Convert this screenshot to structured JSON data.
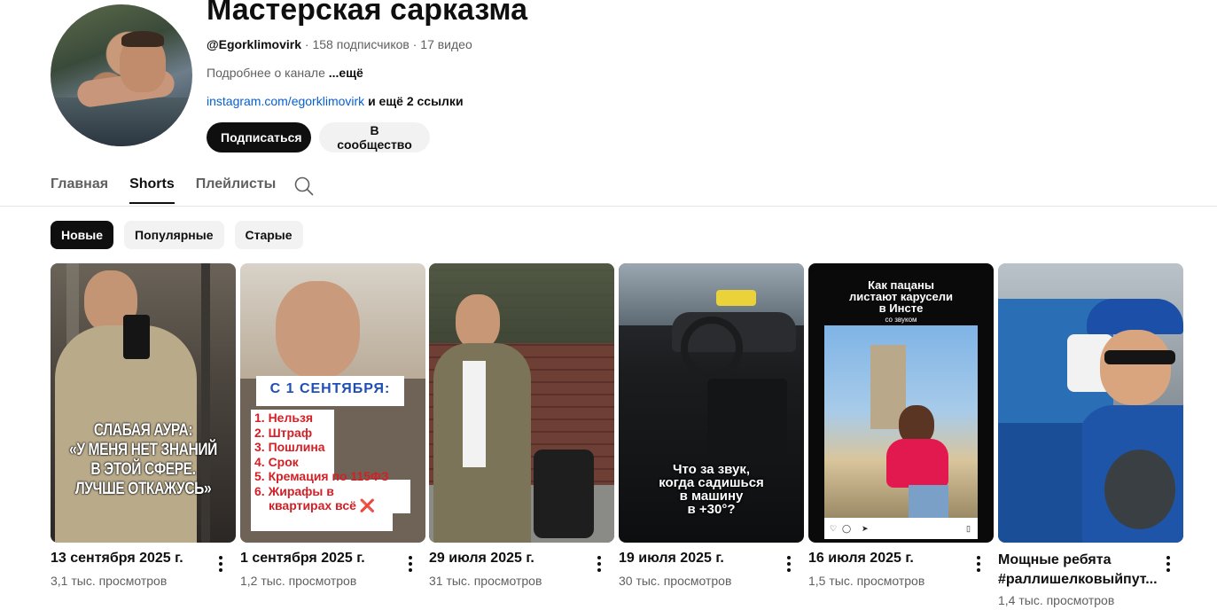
{
  "channel": {
    "title": "Мастерская сарказма",
    "handle": "@Egorklimovirk",
    "subscribers": "158 подписчиков",
    "videos": "17 видео",
    "separator": "·",
    "about_text": "Подробнее о канале",
    "about_more": "...ещё",
    "link_text": "instagram.com/egorklimovirk",
    "links_more": "и ещё 2 ссылки",
    "subscribe_label": "Подписаться",
    "community_label": "В сообщество"
  },
  "tabs": [
    {
      "label": "Главная",
      "active": false
    },
    {
      "label": "Shorts",
      "active": true
    },
    {
      "label": "Плейлисты",
      "active": false
    }
  ],
  "chips": [
    {
      "label": "Новые",
      "active": true
    },
    {
      "label": "Популярные",
      "active": false
    },
    {
      "label": "Старые",
      "active": false
    }
  ],
  "shorts": [
    {
      "title": "13 сентября 2025 г.",
      "views": "3,1 тыс. просмотров",
      "overlay": [
        "СЛАБАЯ АУРА:",
        "«У МЕНЯ НЕТ ЗНАНИЙ",
        "В ЭТОЙ СФЕРЕ.",
        "ЛУЧШЕ ОТКАЖУСЬ»"
      ]
    },
    {
      "title": "1 сентября 2025 г.",
      "views": "1,2 тыс. просмотров",
      "overlay_header": "С 1 СЕНТЯБРЯ:",
      "overlay": [
        "1. Нельзя",
        "2. Штраф",
        "3. Пошлина",
        "4. Срок",
        "5. Кремация по 115ФЗ",
        "6. Жирафы в",
        "квартирах всё ❌"
      ]
    },
    {
      "title": "29 июля 2025 г.",
      "views": "31 тыс. просмотров"
    },
    {
      "title": "19 июля 2025 г.",
      "views": "30 тыс. просмотров",
      "overlay": [
        "Что за звук,",
        "когда садишься",
        "в машину",
        "в +30°?"
      ]
    },
    {
      "title": "16 июля 2025 г.",
      "views": "1,5 тыс. просмотров",
      "overlay": [
        "Как пацаны",
        "листают карусели",
        "в Инсте"
      ],
      "overlay_sub": "со звуком"
    },
    {
      "title_lines": [
        "Мощные ребята",
        "#раллишелковыйпут..."
      ],
      "views": "1,4 тыс. просмотров"
    }
  ],
  "colors": {
    "accent": "#0f0f0f",
    "link": "#065fd4",
    "secondary_text": "#606060",
    "chip_bg": "#f2f2f2",
    "overlay_red": "#d32026",
    "overlay_blue": "#1f4fb5"
  },
  "icons": {
    "search": "search-icon",
    "more": "more-vert-icon"
  }
}
